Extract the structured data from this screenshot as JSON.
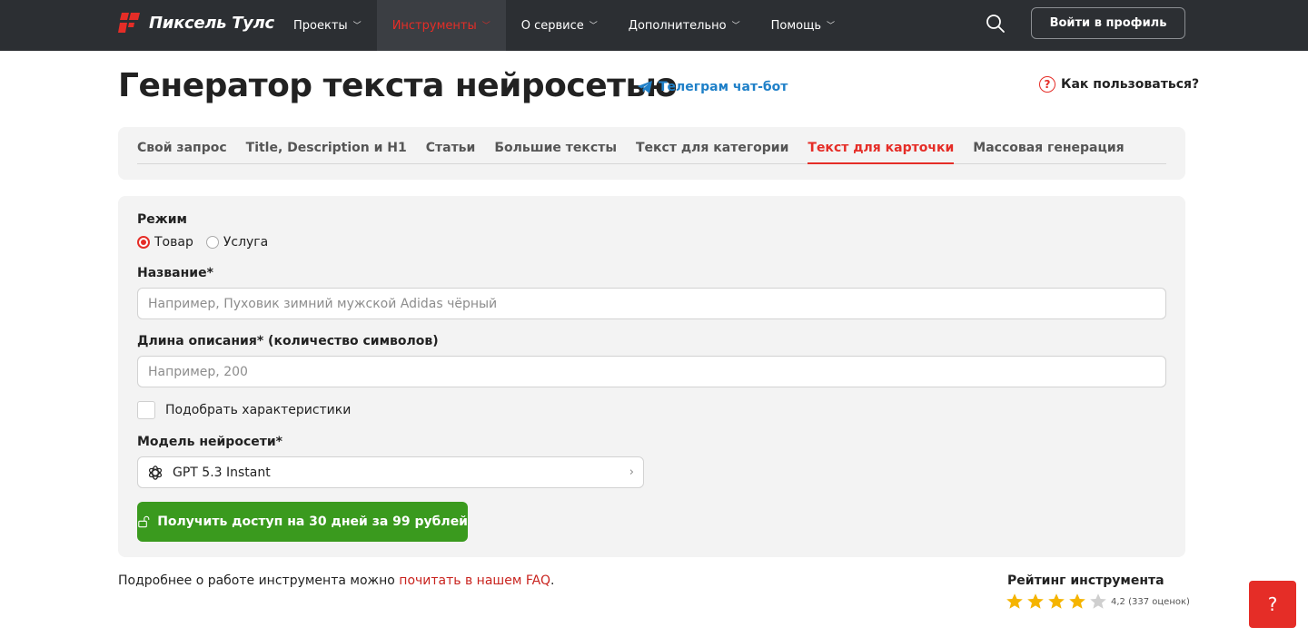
{
  "header": {
    "logo_text": "Пиксель Тулс",
    "nav": [
      {
        "label": "Проекты",
        "active": false
      },
      {
        "label": "Инструменты",
        "active": true
      },
      {
        "label": "О сервисе",
        "active": false
      },
      {
        "label": "Дополнительно",
        "active": false
      },
      {
        "label": "Помощь",
        "active": false
      }
    ],
    "search_icon": "search-icon",
    "login_label": "Войти в профиль"
  },
  "title_row": {
    "title": "Генератор текста нейросетью",
    "telegram_label": "Телеграм чат-бот",
    "help_label": "Как пользоваться?"
  },
  "tabs": [
    {
      "label": "Свой запрос",
      "active": false
    },
    {
      "label": "Title, Description и H1",
      "active": false
    },
    {
      "label": "Статьи",
      "active": false
    },
    {
      "label": "Большие тексты",
      "active": false
    },
    {
      "label": "Текст для категории",
      "active": false
    },
    {
      "label": "Текст для карточки",
      "active": true
    },
    {
      "label": "Массовая генерация",
      "active": false
    }
  ],
  "form": {
    "mode_label": "Режим",
    "mode_options": [
      {
        "label": "Товар",
        "checked": true
      },
      {
        "label": "Услуга",
        "checked": false
      }
    ],
    "name_label": "Название*",
    "name_placeholder": "Например, Пуховик зимний мужской Adidas чёрный",
    "name_value": "",
    "length_label": "Длина описания* (количество символов)",
    "length_placeholder": "Например, 200",
    "length_value": "",
    "features_label": "Подобрать характеристики",
    "features_checked": false,
    "model_label": "Модель нейросети*",
    "model_value": "GPT 5.3 Instant",
    "model_icon": "openai-icon",
    "cta_label": "Получить доступ на 30 дней за 99 рублей"
  },
  "footer": {
    "faq_prefix": "Подробнее о работе инструмента можно ",
    "faq_link": "почитать в нашем FAQ",
    "faq_suffix": ".",
    "rating_title": "Рейтинг инструмента",
    "rating_value": 4.2,
    "rating_max": 5,
    "rating_text": "4,2 (337 оценок)",
    "help_fab": "?"
  },
  "colors": {
    "accent": "#e52d27",
    "header_bg": "#2c2f33",
    "cta_green": "#3a9a1e",
    "link_blue": "#1f80c8",
    "star_gold": "#f5b400",
    "star_grey": "#cfcfcf"
  }
}
